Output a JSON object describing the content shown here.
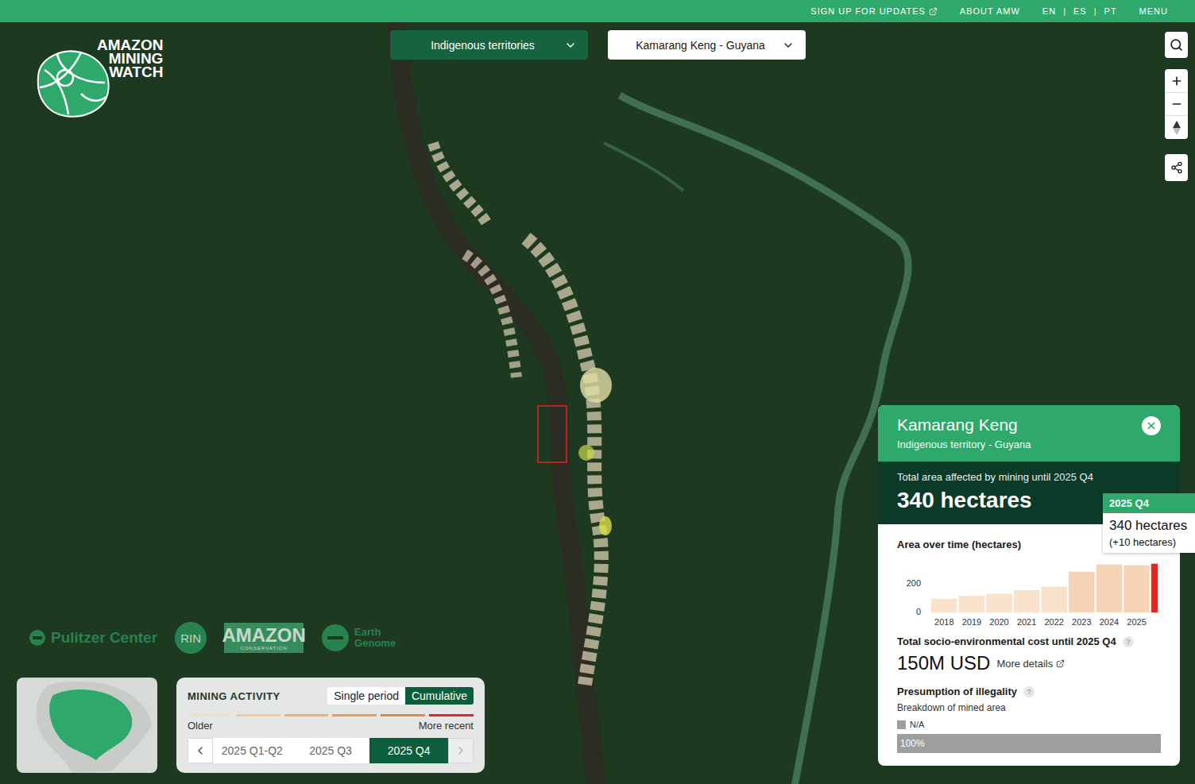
{
  "top_bar": {
    "links": [
      {
        "label": "SIGN UP FOR UPDATES",
        "external": true
      },
      {
        "label": "ABOUT AMW",
        "external": false
      }
    ],
    "languages": [
      "EN",
      "ES",
      "PT"
    ],
    "separator": "|",
    "menu": "MENU"
  },
  "logo": {
    "lines": [
      "AMAZON",
      "MINING",
      "WATCH"
    ]
  },
  "filters": [
    {
      "label": "Indigenous territories",
      "kind": "dark"
    },
    {
      "label": "Kamarang Keng - Guyana",
      "kind": "light"
    }
  ],
  "partners": [
    {
      "kind": "pulitzer",
      "name": "Pulitzer Center"
    },
    {
      "kind": "rin",
      "name": "RIN"
    },
    {
      "kind": "amazon",
      "name": "AMAZON",
      "sub": "CONSERVATION"
    },
    {
      "kind": "earth",
      "name": "Earth",
      "sub": "Genome"
    }
  ],
  "mining_activity": {
    "title": "MINING ACTIVITY",
    "modes": [
      {
        "label": "Single period",
        "selected": false
      },
      {
        "label": "Cumulative",
        "selected": true
      }
    ],
    "legend": {
      "older": "Older",
      "recent": "More recent",
      "segments": [
        {
          "color": "#f8dcc0"
        },
        {
          "color": "#f5c99a"
        },
        {
          "color": "#f1b071"
        },
        {
          "color": "#ec9a52"
        },
        {
          "color": "#e8843f"
        },
        {
          "color": "#e0262a"
        }
      ]
    },
    "prev": {
      "disabled": false
    },
    "periods": [
      {
        "label": "2025 Q1-Q2",
        "selected": false
      },
      {
        "label": "2025 Q3",
        "selected": false
      },
      {
        "label": "2025 Q4",
        "selected": true
      }
    ],
    "next": {
      "disabled": true
    }
  },
  "info_panel": {
    "title": "Kamarang Keng",
    "subtitle": "Indigenous territory - Guyana",
    "total_label": "Total area affected by mining until 2025 Q4",
    "total_value": "340 hectares",
    "chart": {
      "title": "Area over time (hectares)",
      "y_ticks": [
        "200",
        "0"
      ],
      "x_labels": [
        "2018",
        "2019",
        "2020",
        "2021",
        "2022",
        "2023",
        "2024",
        "2025"
      ],
      "bars": [
        {
          "value": 95,
          "selected": false
        },
        {
          "value": 115,
          "selected": false
        },
        {
          "value": 130,
          "selected": false
        },
        {
          "value": 155,
          "selected": false
        },
        {
          "value": 180,
          "selected": false
        },
        {
          "value": 285,
          "selected": false
        },
        {
          "value": 335,
          "selected": false
        },
        {
          "value": 330,
          "selected": false
        },
        {
          "value": 340,
          "selected": true
        }
      ]
    },
    "cost": {
      "label": "Total socio-environmental cost until 2025 Q4",
      "help": "?",
      "value": "150M USD",
      "link": "More details"
    },
    "illegality": {
      "title": "Presumption of illegality",
      "help": "?",
      "subtitle": "Breakdown of mined area",
      "legend": [
        {
          "label": "N/A",
          "color": "#9e9e9e"
        }
      ],
      "segments": [
        {
          "label": "100%",
          "level": 1,
          "color": "#9e9e9e"
        }
      ]
    }
  },
  "tooltip": {
    "title": "2025 Q4",
    "value": "340 hectares",
    "delta": "(+10 hectares)"
  }
}
